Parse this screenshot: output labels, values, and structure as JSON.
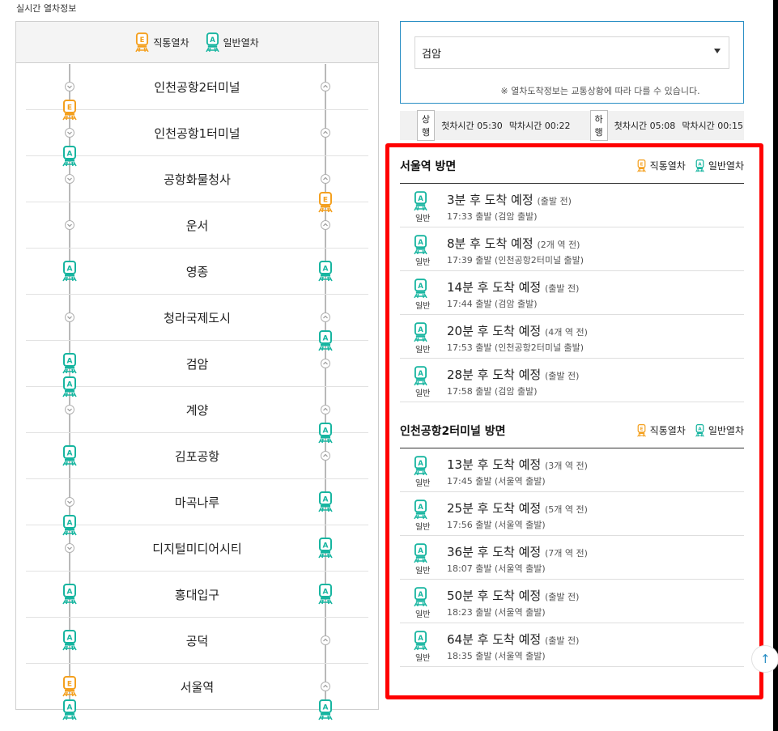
{
  "page_title": "실시간 열차정보",
  "colors": {
    "express": "#f4a01f",
    "local": "#17b5a0",
    "highlight": "#ff0000",
    "accent": "#2a8fc5"
  },
  "legend": {
    "express_label": "직통열차",
    "local_label": "일반열차",
    "express_letter": "E",
    "local_letter": "A"
  },
  "stations": [
    "인천공항2터미널",
    "인천공항1터미널",
    "공항화물청사",
    "운서",
    "영종",
    "청라국제도시",
    "검암",
    "계양",
    "김포공항",
    "마곡나루",
    "디지털미디어시티",
    "홍대입구",
    "공덕",
    "서울역"
  ],
  "left_trains": [
    {
      "type": "E",
      "pos": 1.5
    },
    {
      "type": "A",
      "pos": 2.5
    },
    {
      "type": "A",
      "pos": 5.0
    },
    {
      "type": "A",
      "pos": 7.0
    },
    {
      "type": "A",
      "pos": 7.5
    },
    {
      "type": "A",
      "pos": 9.0
    },
    {
      "type": "A",
      "pos": 10.5
    },
    {
      "type": "A",
      "pos": 12.0
    },
    {
      "type": "A",
      "pos": 13.0
    },
    {
      "type": "E",
      "pos": 14.0
    },
    {
      "type": "A",
      "pos": 14.5
    }
  ],
  "right_trains": [
    {
      "type": "E",
      "pos": 3.5
    },
    {
      "type": "A",
      "pos": 5.0
    },
    {
      "type": "A",
      "pos": 6.5
    },
    {
      "type": "A",
      "pos": 8.5
    },
    {
      "type": "A",
      "pos": 10.0
    },
    {
      "type": "A",
      "pos": 11.0
    },
    {
      "type": "A",
      "pos": 12.0
    },
    {
      "type": "A",
      "pos": 14.5
    }
  ],
  "selector": {
    "value": "검암",
    "notice": "※ 열차도착정보는 교통상황에 따라 다를 수 있습니다."
  },
  "times": {
    "up_label": "상행",
    "up_first": "첫차시간 05:30",
    "up_last": "막차시간 00:22",
    "down_label": "하행",
    "down_first": "첫차시간 05:08",
    "down_last": "막차시간 00:15"
  },
  "sections": [
    {
      "title": "서울역 방면",
      "arrivals": [
        {
          "type_label": "일반",
          "main": "3분 후 도착 예정",
          "state": "(출발 전)",
          "sub": "17:33 출발 (검암 출발)"
        },
        {
          "type_label": "일반",
          "main": "8분 후 도착 예정",
          "state": "(2개 역 전)",
          "sub": "17:39 출발 (인천공항2터미널 출발)"
        },
        {
          "type_label": "일반",
          "main": "14분 후 도착 예정",
          "state": "(출발 전)",
          "sub": "17:44 출발 (검암 출발)"
        },
        {
          "type_label": "일반",
          "main": "20분 후 도착 예정",
          "state": "(4개 역 전)",
          "sub": "17:53 출발 (인천공항2터미널 출발)"
        },
        {
          "type_label": "일반",
          "main": "28분 후 도착 예정",
          "state": "(출발 전)",
          "sub": "17:58 출발 (검암 출발)"
        }
      ]
    },
    {
      "title": "인천공항2터미널 방면",
      "arrivals": [
        {
          "type_label": "일반",
          "main": "13분 후 도착 예정",
          "state": "(3개 역 전)",
          "sub": "17:45 출발 (서울역 출발)"
        },
        {
          "type_label": "일반",
          "main": "25분 후 도착 예정",
          "state": "(5개 역 전)",
          "sub": "17:56 출발 (서울역 출발)"
        },
        {
          "type_label": "일반",
          "main": "36분 후 도착 예정",
          "state": "(7개 역 전)",
          "sub": "18:07 출발 (서울역 출발)"
        },
        {
          "type_label": "일반",
          "main": "50분 후 도착 예정",
          "state": "(출발 전)",
          "sub": "18:23 출발 (서울역 출발)"
        },
        {
          "type_label": "일반",
          "main": "64분 후 도착 예정",
          "state": "(출발 전)",
          "sub": "18:35 출발 (서울역 출발)"
        }
      ]
    }
  ],
  "top_button_icon": "arrow-up-icon"
}
